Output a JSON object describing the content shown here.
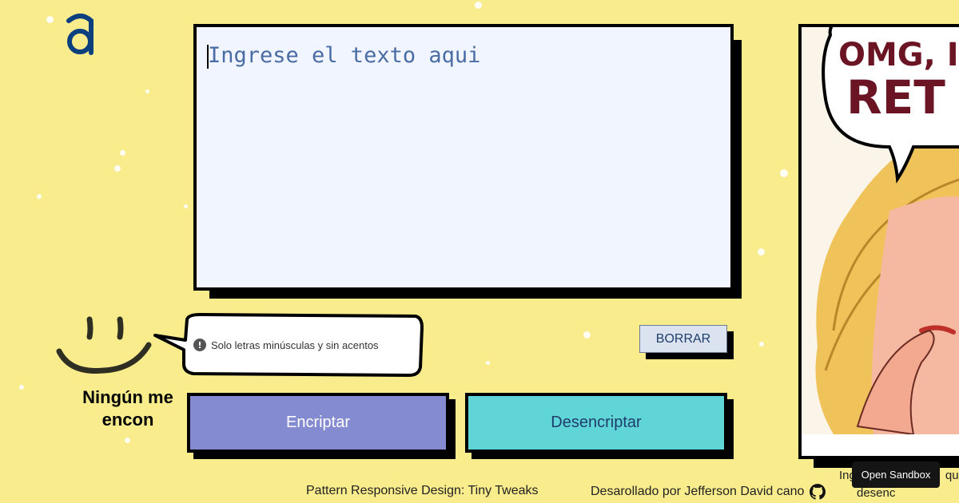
{
  "logo": {
    "icon": "alura-logo-icon",
    "color": "#0b3f7e"
  },
  "editor": {
    "placeholder": "Ingrese el texto aqui",
    "value": ""
  },
  "hint": {
    "icon": "alert-circle-icon",
    "text": "Solo letras minúsculas y sin acentos"
  },
  "buttons": {
    "clear": "BORRAR",
    "encrypt": "Encriptar",
    "decrypt": "Desencriptar"
  },
  "result_panel": {
    "comic_text": "OMG, I RET",
    "title_line1": "Ningún me",
    "title_line2": "encon",
    "subtitle_line1": "Ing",
    "subtitle_line2": "desenc",
    "subtitle_line1_tail": "que"
  },
  "sandbox": {
    "label": "Open Sandbox"
  },
  "footer": {
    "pattern_credit": "Pattern Responsive Design: Tiny Tweaks",
    "developer_credit": "Desarollado por Jefferson David cano",
    "github_icon": "github-icon"
  },
  "colors": {
    "background": "#f9ec8d",
    "encrypt_button": "#858bd1",
    "decrypt_button": "#60d5d7",
    "editor_background": "#f1f5ff",
    "text_blue": "#4a6ca5"
  }
}
